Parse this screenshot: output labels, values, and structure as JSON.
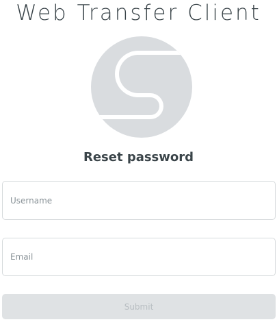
{
  "header": {
    "title": "Web Transfer Client"
  },
  "logo": {
    "icon": "s-logo-icon",
    "color": "#d9dcdf"
  },
  "form": {
    "heading": "Reset password",
    "username_placeholder": "Username",
    "email_placeholder": "Email",
    "submit_label": "Submit"
  }
}
